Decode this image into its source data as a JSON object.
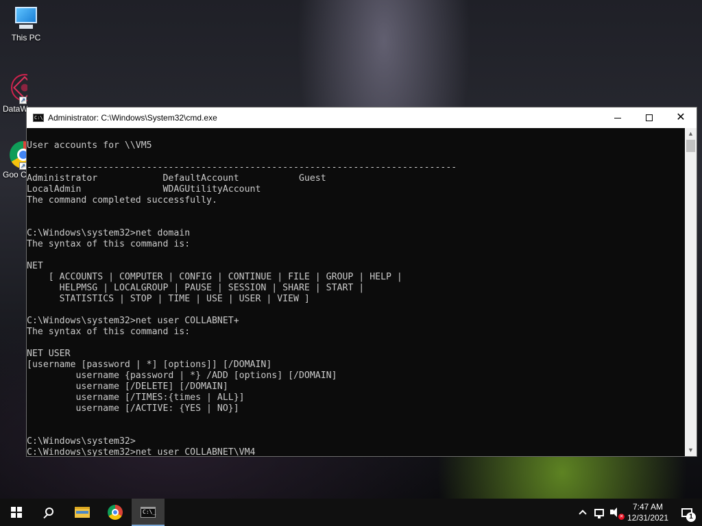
{
  "desktop": {
    "icons": [
      {
        "label": "This PC"
      },
      {
        "label": "DataW"
      },
      {
        "label": "Goo Chr"
      }
    ]
  },
  "window": {
    "title": "Administrator: C:\\Windows\\System32\\cmd.exe",
    "icon_text": "C:\\",
    "console_lines": [
      "User accounts for \\\\VM5",
      "",
      "-------------------------------------------------------------------------------",
      "Administrator            DefaultAccount           Guest",
      "LocalAdmin               WDAGUtilityAccount",
      "The command completed successfully.",
      "",
      "",
      "C:\\Windows\\system32>net domain",
      "The syntax of this command is:",
      "",
      "NET",
      "    [ ACCOUNTS | COMPUTER | CONFIG | CONTINUE | FILE | GROUP | HELP |",
      "      HELPMSG | LOCALGROUP | PAUSE | SESSION | SHARE | START |",
      "      STATISTICS | STOP | TIME | USE | USER | VIEW ]",
      "",
      "C:\\Windows\\system32>net user COLLABNET+",
      "The syntax of this command is:",
      "",
      "NET USER",
      "[username [password | *] [options]] [/DOMAIN]",
      "         username {password | *} /ADD [options] [/DOMAIN]",
      "         username [/DELETE] [/DOMAIN]",
      "         username [/TIMES:{times | ALL}]",
      "         username [/ACTIVE: {YES | NO}]",
      "",
      "",
      "C:\\Windows\\system32>",
      "C:\\Windows\\system32>net user COLLABNET\\VM4"
    ]
  },
  "taskbar": {
    "cmd_icon_text": "C:\\_",
    "clock_time": "7:47 AM",
    "clock_date": "12/31/2021",
    "notification_count": "1",
    "volume_muted_mark": "✕"
  },
  "colors": {
    "console_bg": "#0c0c0c",
    "console_text": "#cccccc",
    "taskbar_bg": "#101010"
  }
}
